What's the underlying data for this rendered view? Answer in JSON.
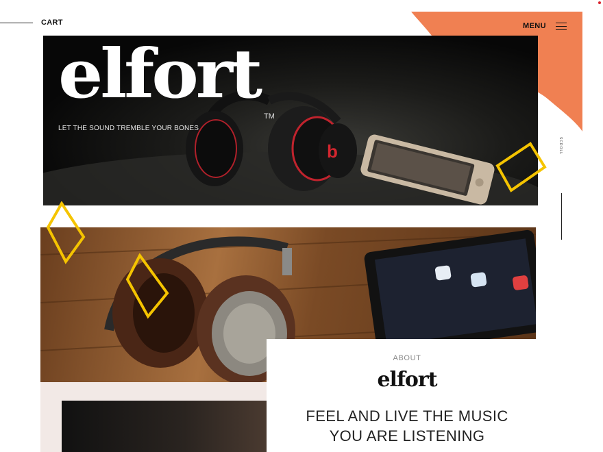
{
  "header": {
    "cart_label": "CART",
    "menu_label": "MENU"
  },
  "hero": {
    "brand": "elfort",
    "trademark": "TM",
    "tagline": "LET THE SOUND TREMBLE YOUR BONES"
  },
  "scroll": {
    "label": "SCROLL"
  },
  "about": {
    "label": "ABOUT",
    "brand": "elfort",
    "headline_line1": "FEEL AND LIVE THE MUSIC",
    "headline_line2": "YOU ARE LISTENING"
  },
  "colors": {
    "accent_orange": "#f08052",
    "accent_yellow": "#f5c400",
    "text_dark": "#111111",
    "muted_gray": "#8b8b8b"
  },
  "icons": {
    "menu": "hamburger-icon",
    "decor": "diamond-outline-icon"
  }
}
